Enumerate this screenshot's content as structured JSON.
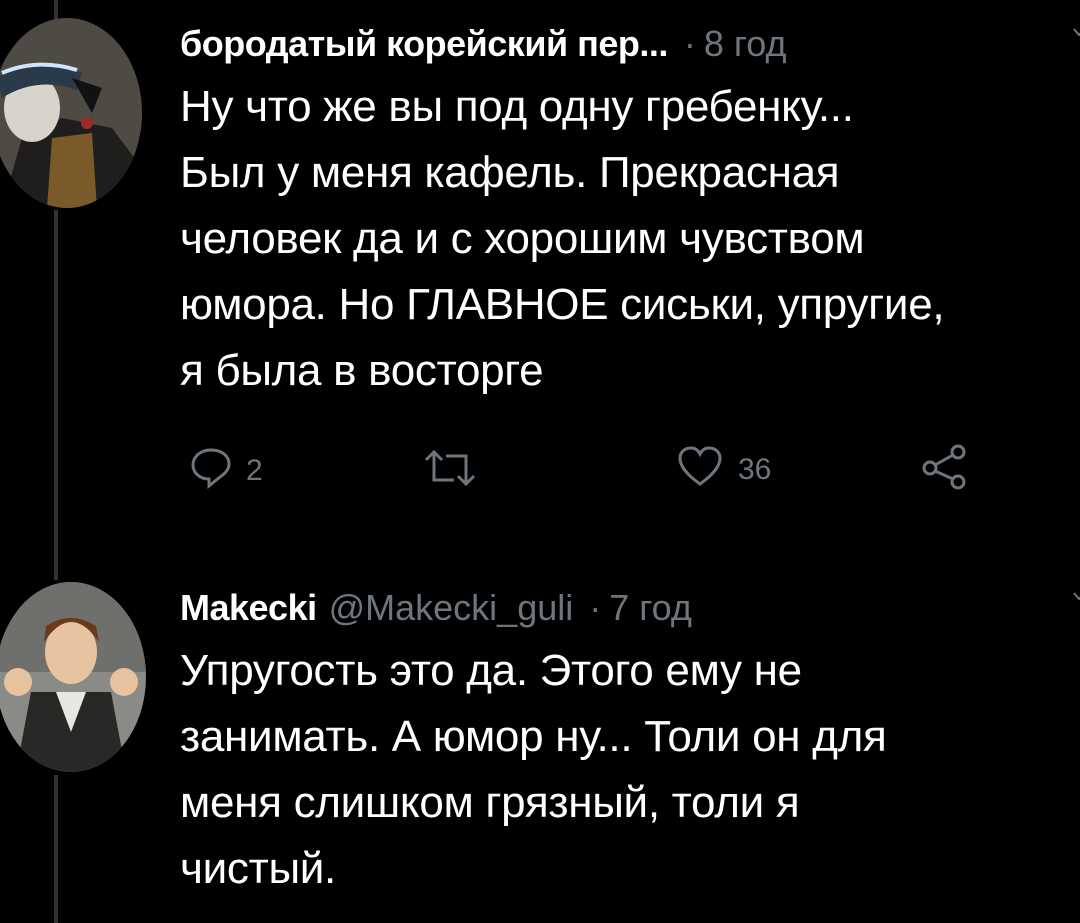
{
  "tweets": [
    {
      "author": "бородатый корейский пер...",
      "handle": "",
      "dot": "·",
      "time": "8 год",
      "lines": [
        "Ну что же вы под одну гребенку...",
        "Был у меня кафель. Прекрасная",
        "человек да и с хорошим чувством",
        "юмора. Но ГЛАВНОЕ сиськи, упругие,",
        "я была в восторге"
      ],
      "replies": "2",
      "retweets": "",
      "likes": "36",
      "avatar_icon": "avatar-anime-character",
      "more_icon": "chevron-down-icon"
    },
    {
      "author": "Makecki",
      "handle": "@Makecki_guli",
      "dot": "·",
      "time": "7 год",
      "lines": [
        "Упругость это да. Этого ему не",
        "занимать. А юмор ну... Толи он для",
        "меня слишком грязный, толи я",
        "чистый."
      ],
      "avatar_icon": "avatar-cartoon-character",
      "more_icon": "chevron-down-icon"
    }
  ],
  "colors": {
    "background": "#000000",
    "text": "#ffffff",
    "muted": "#6e767d",
    "thread_line": "#2f3336"
  }
}
